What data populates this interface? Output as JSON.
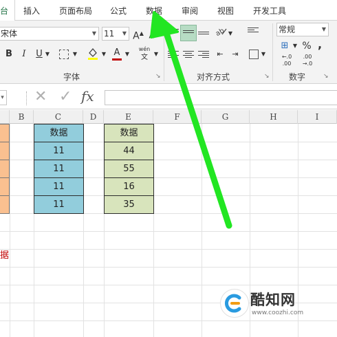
{
  "ribbon_tabs": [
    {
      "label": "台",
      "active": true
    },
    {
      "label": "插入"
    },
    {
      "label": "页面布局"
    },
    {
      "label": "公式"
    },
    {
      "label": "数据"
    },
    {
      "label": "审阅"
    },
    {
      "label": "视图"
    },
    {
      "label": "开发工具"
    }
  ],
  "font": {
    "name": "宋体",
    "size": "11",
    "bold": "B",
    "italic": "I",
    "underline": "U",
    "increase": "A",
    "decrease": "A",
    "font_color_letter": "A",
    "phonetic_top": "wén",
    "phonetic_bottom": "文",
    "group_label": "字体"
  },
  "alignment": {
    "group_label": "对齐方式"
  },
  "number": {
    "format": "常规",
    "percent": "%",
    "comma": ",",
    "inc_decimal_top": "←.0",
    "inc_decimal_bottom": ".00",
    "dec_decimal_top": ".00",
    "dec_decimal_bottom": "→.0",
    "group_label": "数字"
  },
  "formula_bar": {
    "fx": "fx",
    "cancel": "✕",
    "enter": "✓"
  },
  "columns": [
    "B",
    "C",
    "D",
    "E",
    "F",
    "G",
    "H",
    "I"
  ],
  "table_c": {
    "header": "数据",
    "values": [
      "11",
      "11",
      "11",
      "11"
    ]
  },
  "table_e": {
    "header": "数据",
    "values": [
      "44",
      "55",
      "16",
      "35"
    ]
  },
  "red_text": "据",
  "watermark": {
    "title": "酷知网",
    "url": "www.coozhi.com"
  },
  "colors": {
    "excel_green": "#217346",
    "blue_fill": "#92cddc",
    "green_fill": "#d8e4bc",
    "orange_fill": "#fac090",
    "arrow": "#22e622",
    "red_text": "#c00000"
  }
}
